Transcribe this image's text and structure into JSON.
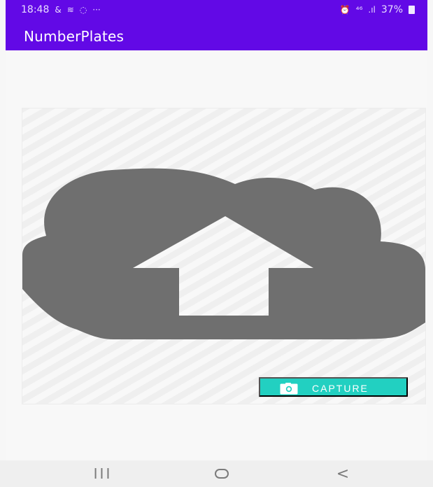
{
  "status_bar": {
    "time": "18:48",
    "left_icons": [
      "&",
      "≋",
      "◌"
    ],
    "dots": "···",
    "right_icons": [
      "⏰",
      "⁴⁶"
    ],
    "signal": ".ıl",
    "battery_percent": "37%"
  },
  "app_bar": {
    "title": "NumberPlates"
  },
  "main": {
    "image_icon": "cloud-upload-icon",
    "capture_button_label": "CAPTURE",
    "capture_icon": "camera-icon"
  },
  "nav_bar": {
    "recent_label": "III",
    "home_icon": "home-icon",
    "back_label": "<"
  },
  "colors": {
    "primary": "#6209e6",
    "accent": "#22d0c1",
    "image_fill": "#6f6f6f",
    "background": "#f7f7f7"
  }
}
